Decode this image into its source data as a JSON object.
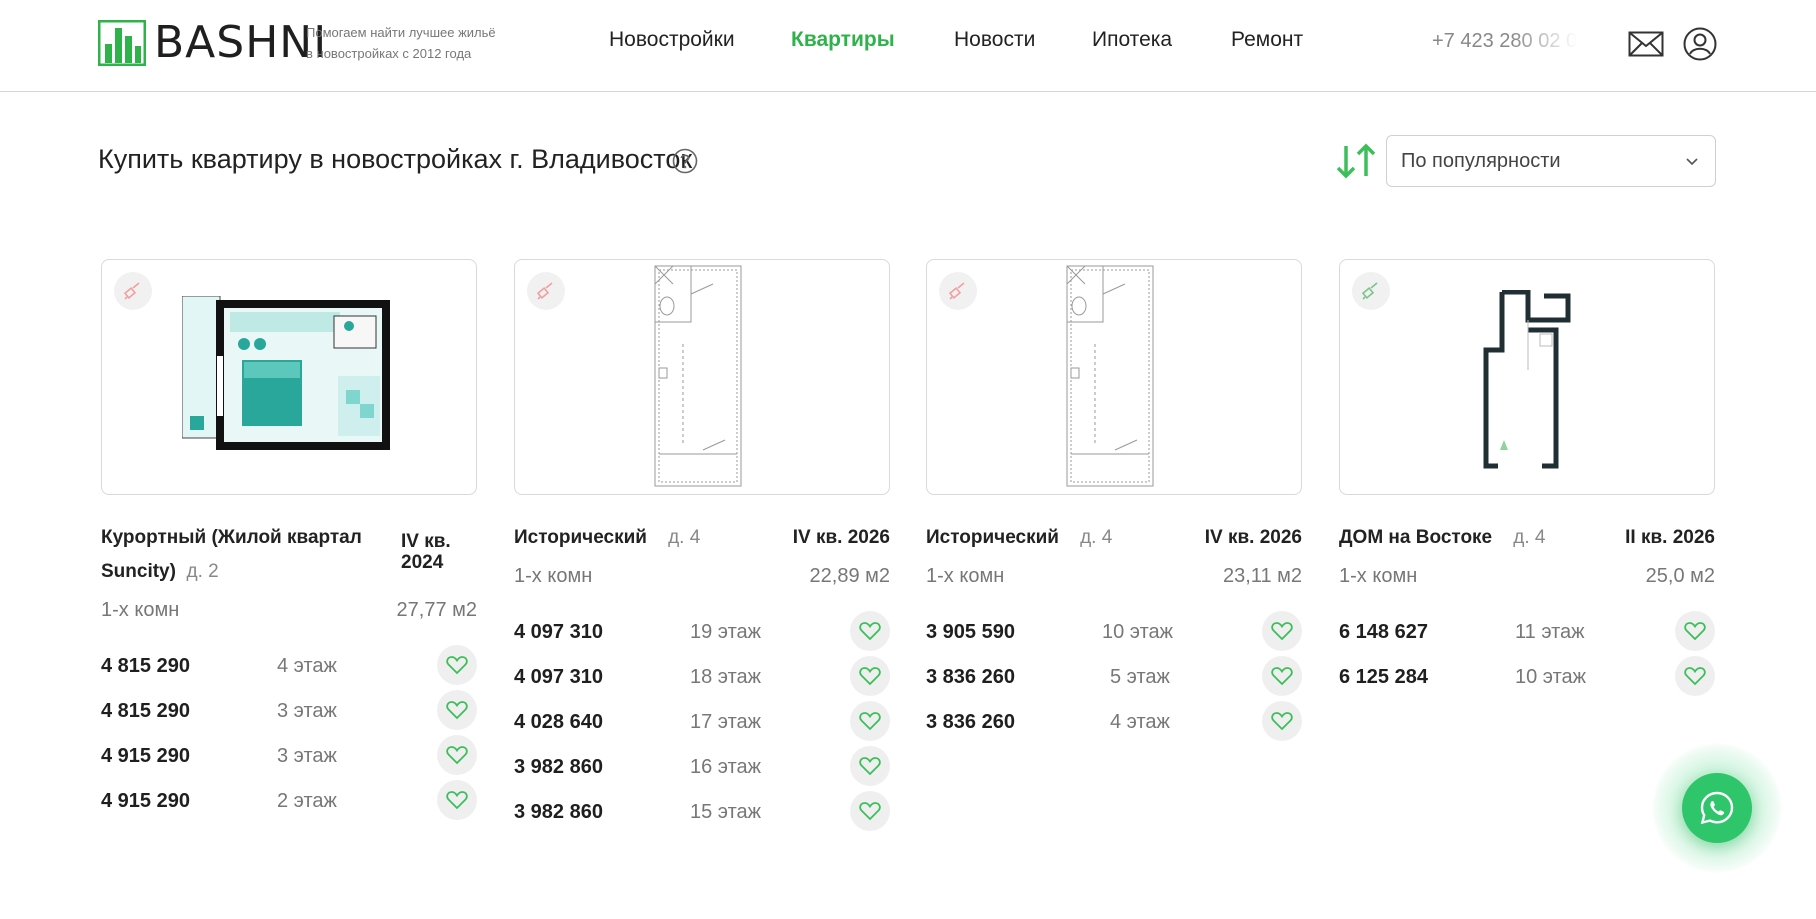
{
  "header": {
    "logo_text": "BASHNI",
    "tagline_line1": "Помогаем найти лучшее жильё",
    "tagline_line2": "в новостройках с 2012 года",
    "nav": [
      {
        "label": "Новостройки",
        "active": false
      },
      {
        "label": "Квартиры",
        "active": true
      },
      {
        "label": "Новости",
        "active": false
      },
      {
        "label": "Ипотека",
        "active": false
      },
      {
        "label": "Ремонт",
        "active": false
      }
    ],
    "phone": "+7 423 280 02 0",
    "icons": [
      "mail-icon",
      "user-icon"
    ]
  },
  "page": {
    "title": "Купить квартиру в новостройках г. Владивосток",
    "help_icon": "question-icon",
    "sort_icon": "sort-arrows-icon",
    "sort_value": "По популярности"
  },
  "cards": [
    {
      "name_line1": "Курортный (Жилой квартал",
      "name_line2": "Suncity)",
      "house": "д. 2",
      "date_line1": "IV кв.",
      "date_line2": "2024",
      "rooms": "1-х комн",
      "area": "27,77 м2",
      "badge_color": "#f0a0a0",
      "rows": [
        {
          "price": "4 815 290",
          "floor": "4 этаж"
        },
        {
          "price": "4 815 290",
          "floor": "3 этаж"
        },
        {
          "price": "4 915 290",
          "floor": "3 этаж"
        },
        {
          "price": "4 915 290",
          "floor": "2 этаж"
        }
      ]
    },
    {
      "name_line1": "Исторический",
      "name_line2": "",
      "house": "д. 4",
      "date_line1": "IV кв. 2026",
      "date_line2": "",
      "rooms": "1-х комн",
      "area": "22,89 м2",
      "badge_color": "#f0a0a0",
      "rows": [
        {
          "price": "4 097 310",
          "floor": "19 этаж"
        },
        {
          "price": "4 097 310",
          "floor": "18 этаж"
        },
        {
          "price": "4 028 640",
          "floor": "17 этаж"
        },
        {
          "price": "3 982 860",
          "floor": "16 этаж"
        },
        {
          "price": "3 982 860",
          "floor": "15 этаж"
        }
      ]
    },
    {
      "name_line1": "Исторический",
      "name_line2": "",
      "house": "д. 4",
      "date_line1": "IV кв. 2026",
      "date_line2": "",
      "rooms": "1-х комн",
      "area": "23,11 м2",
      "badge_color": "#f0a0a0",
      "rows": [
        {
          "price": "3 905 590",
          "floor": "10 этаж"
        },
        {
          "price": "3 836 260",
          "floor": "5 этаж"
        },
        {
          "price": "3 836 260",
          "floor": "4 этаж"
        }
      ]
    },
    {
      "name_line1": "ДОМ на Востоке",
      "name_line2": "",
      "house": "д. 4",
      "date_line1": "II кв. 2026",
      "date_line2": "",
      "rooms": "1-х комн",
      "area": "25,0 м2",
      "badge_color": "#7cc48a",
      "rows": [
        {
          "price": "6 148 627",
          "floor": "11 этаж"
        },
        {
          "price": "6 125 284",
          "floor": "10 этаж"
        }
      ]
    }
  ],
  "colors": {
    "accent": "#2db34a",
    "heart": "#3cbf5a",
    "whatsapp": "#2fc56a"
  },
  "whatsapp_icon": "whatsapp-icon"
}
